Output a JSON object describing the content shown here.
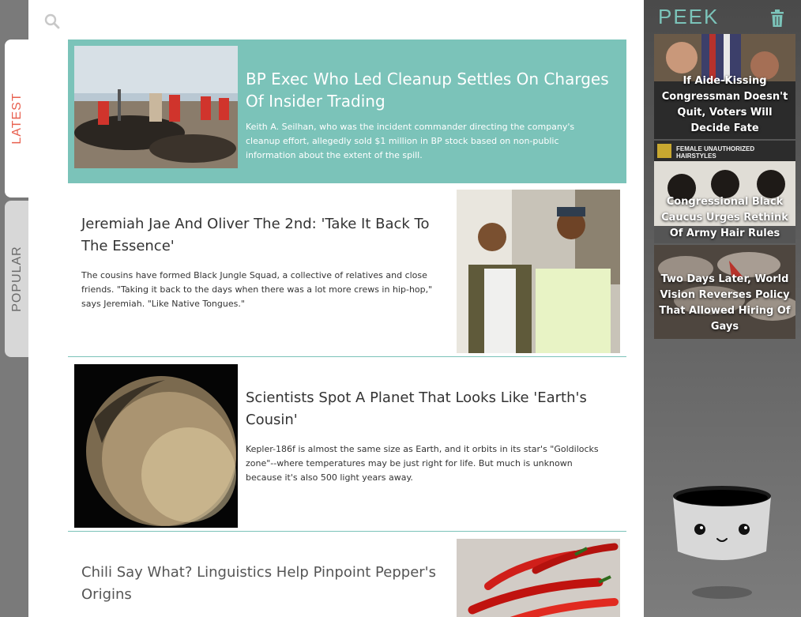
{
  "tabs": {
    "latest": "LATEST",
    "popular": "POPULAR"
  },
  "search": {
    "icon": "search-icon"
  },
  "articles": [
    {
      "headline": "BP Exec Who Led Cleanup Settles On Charges Of Insider Trading",
      "summary": "Keith A. Seilhan, who was the incident commander directing the company's cleanup effort, allegedly sold $1 million in BP stock based on non-public information about the extent of the spill."
    },
    {
      "headline": "Jeremiah Jae And Oliver The 2nd: 'Take It Back To The Essence'",
      "summary": "The cousins have formed Black Jungle Squad, a collective of relatives and close friends. \"Taking it back to the days when there was a lot more crews in hip-hop,\" says Jeremiah. \"Like Native Tongues.\""
    },
    {
      "headline": "Scientists Spot A Planet That Looks Like 'Earth's Cousin'",
      "summary": "Kepler-186f is almost the same size as Earth, and it orbits in its star's \"Goldilocks zone\"--where temperatures may be just right for life. But much is unknown because it's also 500 light years away."
    },
    {
      "headline": "Chili Say What? Linguistics Help Pinpoint Pepper's Origins",
      "summary": ""
    }
  ],
  "peek": {
    "title": "PEEK",
    "trash_icon": "trash-icon",
    "items": [
      {
        "caption": "If Aide-Kissing Congressman Doesn't Quit, Voters Will Decide Fate"
      },
      {
        "caption": "Congressional Black Caucus Urges Rethink Of Army Hair Rules",
        "image_text": "FEMALE UNAUTHORIZED HAIRSTYLES"
      },
      {
        "caption": "Two Days Later, World Vision Reverses Policy That Allowed Hiring Of Gays"
      }
    ]
  },
  "colors": {
    "accent": "#7bc3b9",
    "latest_tab": "#e8604f",
    "popular_tab": "#d7d7d7",
    "rail": "#7a7a7a"
  }
}
